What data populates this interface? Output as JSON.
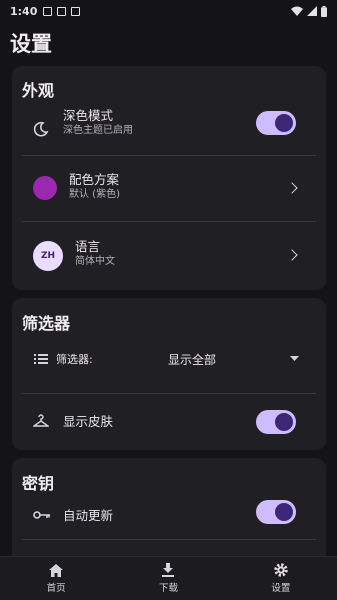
{
  "status_bar": {
    "time": "1:40"
  },
  "header": {
    "title": "设置"
  },
  "appearance": {
    "title": "外观",
    "dark_mode": {
      "title": "深色模式",
      "subtitle": "深色主题已启用",
      "enabled": true
    },
    "color_scheme": {
      "title": "配色方案",
      "subtitle": "默认 (紫色)",
      "swatch_color": "#9c27b0"
    },
    "language": {
      "title": "语言",
      "subtitle": "简体中文",
      "badge": "ZH"
    }
  },
  "filters": {
    "title": "筛选器",
    "filter_label": "筛选器:",
    "filter_value": "显示全部",
    "show_skins": {
      "title": "显示皮肤",
      "enabled": true
    }
  },
  "keys": {
    "title": "密钥",
    "auto_update": {
      "title": "自动更新",
      "enabled": true
    }
  },
  "bottom_nav": {
    "items": [
      {
        "label": "首页",
        "icon": "home-icon"
      },
      {
        "label": "下载",
        "icon": "download-icon"
      },
      {
        "label": "设置",
        "icon": "gear-icon"
      }
    ]
  },
  "colors": {
    "accent": "#cfbcff",
    "toggle_knob": "#3a2776",
    "card": "#201f23",
    "background": "#141316"
  }
}
